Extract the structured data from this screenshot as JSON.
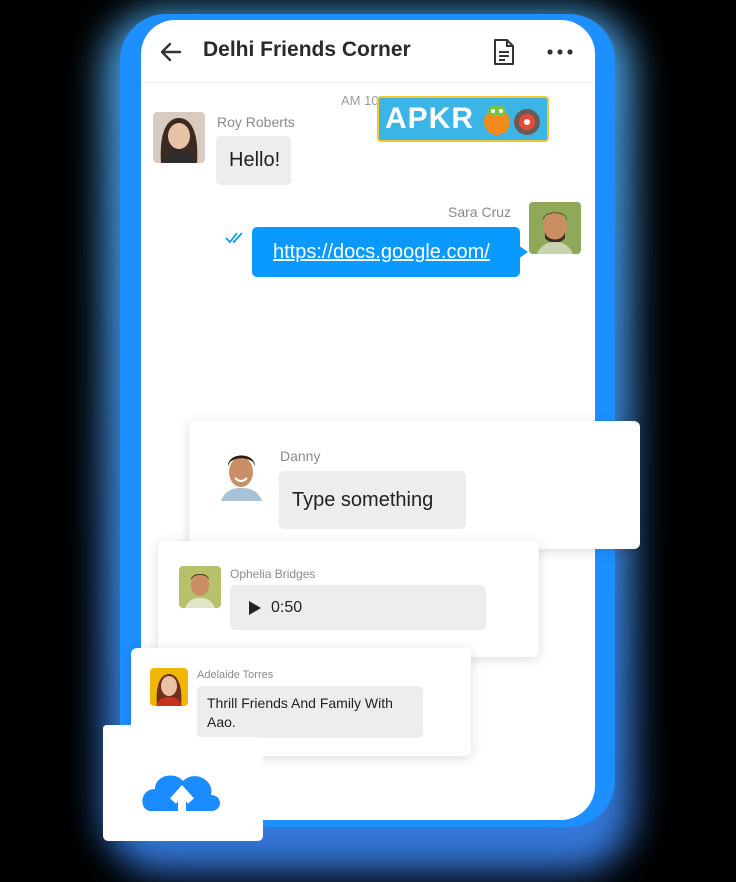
{
  "header": {
    "title": "Delhi Friends Corner",
    "back_icon": "arrow-left-icon",
    "doc_icon": "document-icon",
    "more_icon": "more-horizontal-icon"
  },
  "chat": {
    "time_label": "AM 10",
    "logo_text": "APKR",
    "messages": [
      {
        "sender": "Roy Roberts",
        "text": "Hello!"
      },
      {
        "sender": "Sara Cruz",
        "text": "https://docs.google.com/"
      }
    ]
  },
  "cards": {
    "danny": {
      "sender": "Danny",
      "text": "Type something"
    },
    "ophelia": {
      "sender": "Ophelia Bridges",
      "duration": "0:50"
    },
    "adelaide": {
      "sender": "Adelaide Torres",
      "text_line1": "Thrill Friends And Family With",
      "text_line2": "Aao."
    }
  },
  "upload": {
    "icon": "cloud-upload-icon"
  },
  "colors": {
    "accent": "#0a99ff",
    "glow": "#57b8ff",
    "phone_frame": "#1e8fff"
  }
}
